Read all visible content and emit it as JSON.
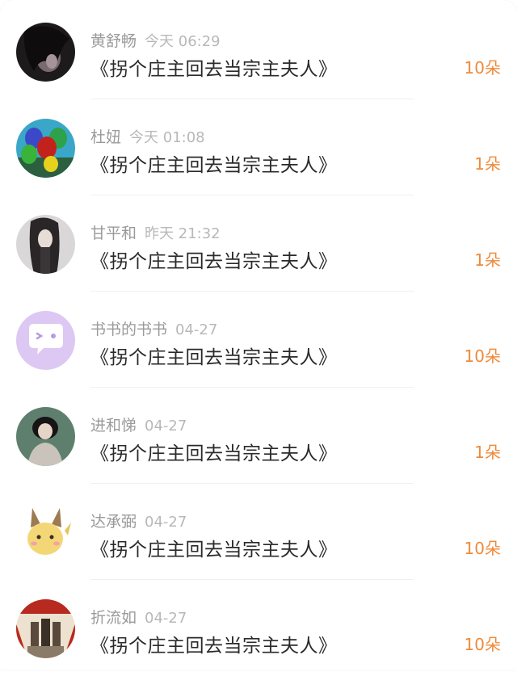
{
  "colors": {
    "accent": "#ef8a3a",
    "name_text": "#9a9a9a",
    "title_text": "#2a2a2a"
  },
  "records": [
    {
      "name": "黄舒畅",
      "time": "今天 06:29",
      "book": "《拐个庄主回去当宗主夫人》",
      "amount": "10朵",
      "avatar": "dark-portrait-avatar"
    },
    {
      "name": "杜妞",
      "time": "今天 01:08",
      "book": "《拐个庄主回去当宗主夫人》",
      "amount": "1朵",
      "avatar": "balloons-avatar"
    },
    {
      "name": "甘平和",
      "time": "昨天 21:32",
      "book": "《拐个庄主回去当宗主夫人》",
      "amount": "1朵",
      "avatar": "long-hair-portrait-avatar"
    },
    {
      "name": "书书的书书",
      "time": "04-27",
      "book": "《拐个庄主回去当宗主夫人》",
      "amount": "10朵",
      "avatar": "chat-bubble-avatar"
    },
    {
      "name": "进和悌",
      "time": "04-27",
      "book": "《拐个庄主回去当宗主夫人》",
      "amount": "1朵",
      "avatar": "woman-portrait-avatar"
    },
    {
      "name": "达承弼",
      "time": "04-27",
      "book": "《拐个庄主回去当宗主夫人》",
      "amount": "10朵",
      "avatar": "cartoon-creature-avatar"
    },
    {
      "name": "折流如",
      "time": "04-27",
      "book": "《拐个庄主回去当宗主夫人》",
      "amount": "10朵",
      "avatar": "poster-avatar"
    }
  ]
}
